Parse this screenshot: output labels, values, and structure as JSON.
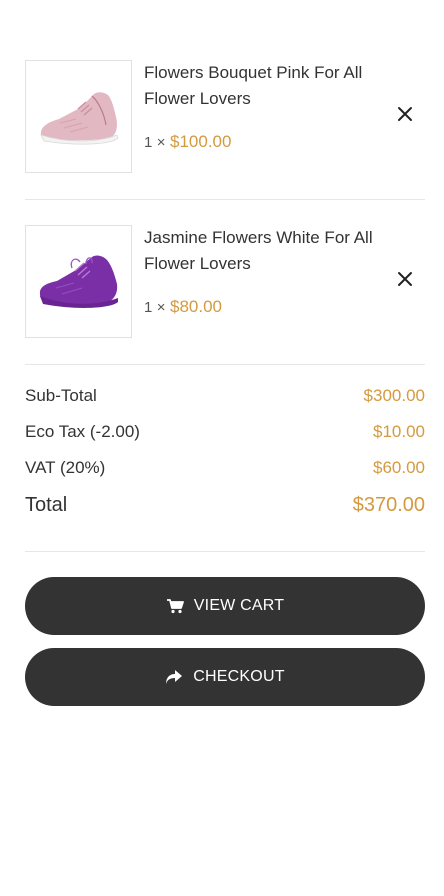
{
  "cart": {
    "items": [
      {
        "name": "Flowers Bouquet Pink For All Flower Lovers",
        "qty": "1",
        "times": "×",
        "price": "$100.00",
        "image": "pink-sneaker-image",
        "image_color": "#d9a8b5"
      },
      {
        "name": "Jasmine Flowers White For All Flower Lovers",
        "qty": "1",
        "times": "×",
        "price": "$80.00",
        "image": "purple-sneaker-image",
        "image_color": "#7b2fa6"
      }
    ]
  },
  "totals": {
    "subtotal_label": "Sub-Total",
    "subtotal_value": "$300.00",
    "ecotax_label": "Eco Tax (-2.00)",
    "ecotax_value": "$10.00",
    "vat_label": "VAT (20%)",
    "vat_value": "$60.00",
    "total_label": "Total",
    "total_value": "$370.00"
  },
  "actions": {
    "view_cart_label": "VIEW CART",
    "view_cart_icon": "cart-icon",
    "checkout_label": "CHECKOUT",
    "checkout_icon": "share-arrow-icon"
  },
  "colors": {
    "accent": "#d49a3f",
    "button_bg": "#333333",
    "button_text": "#ffffff"
  }
}
